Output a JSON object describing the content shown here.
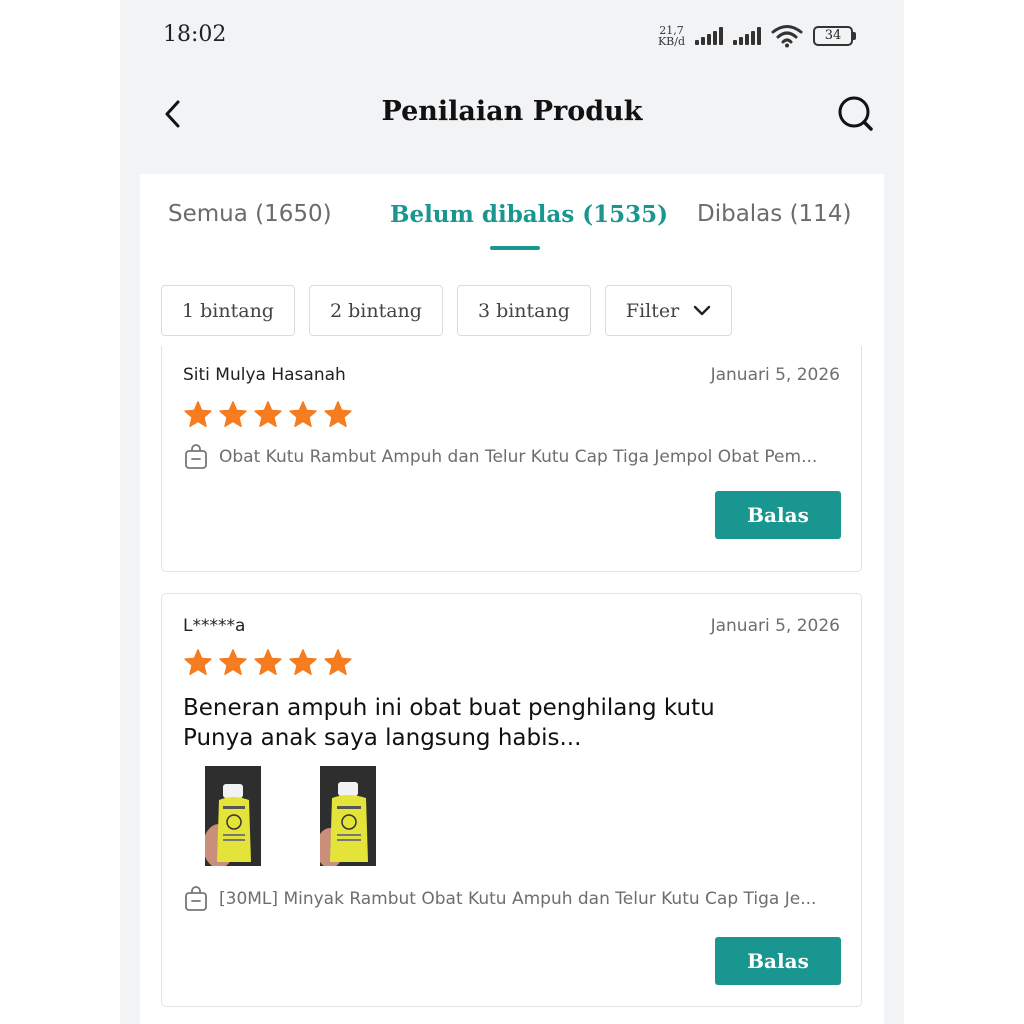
{
  "status_bar": {
    "time": "18:02",
    "net_speed_value": "21,7",
    "net_speed_unit": "KB/d",
    "battery": "34"
  },
  "header": {
    "title": "Penilaian Produk",
    "back_icon": "chevron-left-icon",
    "search_icon": "search-icon"
  },
  "tabs": [
    {
      "label": "Semua (1650)",
      "active": false
    },
    {
      "label": "Belum dibalas (1535)",
      "active": true
    },
    {
      "label": "Dibalas (114)",
      "active": false
    }
  ],
  "filters": [
    {
      "label": "1 bintang"
    },
    {
      "label": "2 bintang"
    },
    {
      "label": "3 bintang"
    },
    {
      "label": "Filter",
      "icon": "chevron-down-icon"
    }
  ],
  "reviews": [
    {
      "reviewer": "Siti Mulya Hasanah",
      "date": "Januari 5, 2026",
      "rating": 5,
      "product": "Obat Kutu Rambut Ampuh dan Telur Kutu Cap Tiga Jempol Obat Pem...",
      "reply_label": "Balas"
    },
    {
      "reviewer": "L*****a",
      "date": "Januari 5, 2026",
      "rating": 5,
      "text_line1": "Beneran ampuh ini obat buat penghilang kutu",
      "text_line2": "Punya anak saya langsung habis...",
      "photo_count": 2,
      "product": "[30ML] Minyak Rambut Obat Kutu Ampuh dan Telur Kutu Cap Tiga Je...",
      "reply_label": "Balas"
    }
  ],
  "colors": {
    "accent": "#1a9690",
    "star": "#f57c1f",
    "page_bg": "#f2f3f5"
  }
}
